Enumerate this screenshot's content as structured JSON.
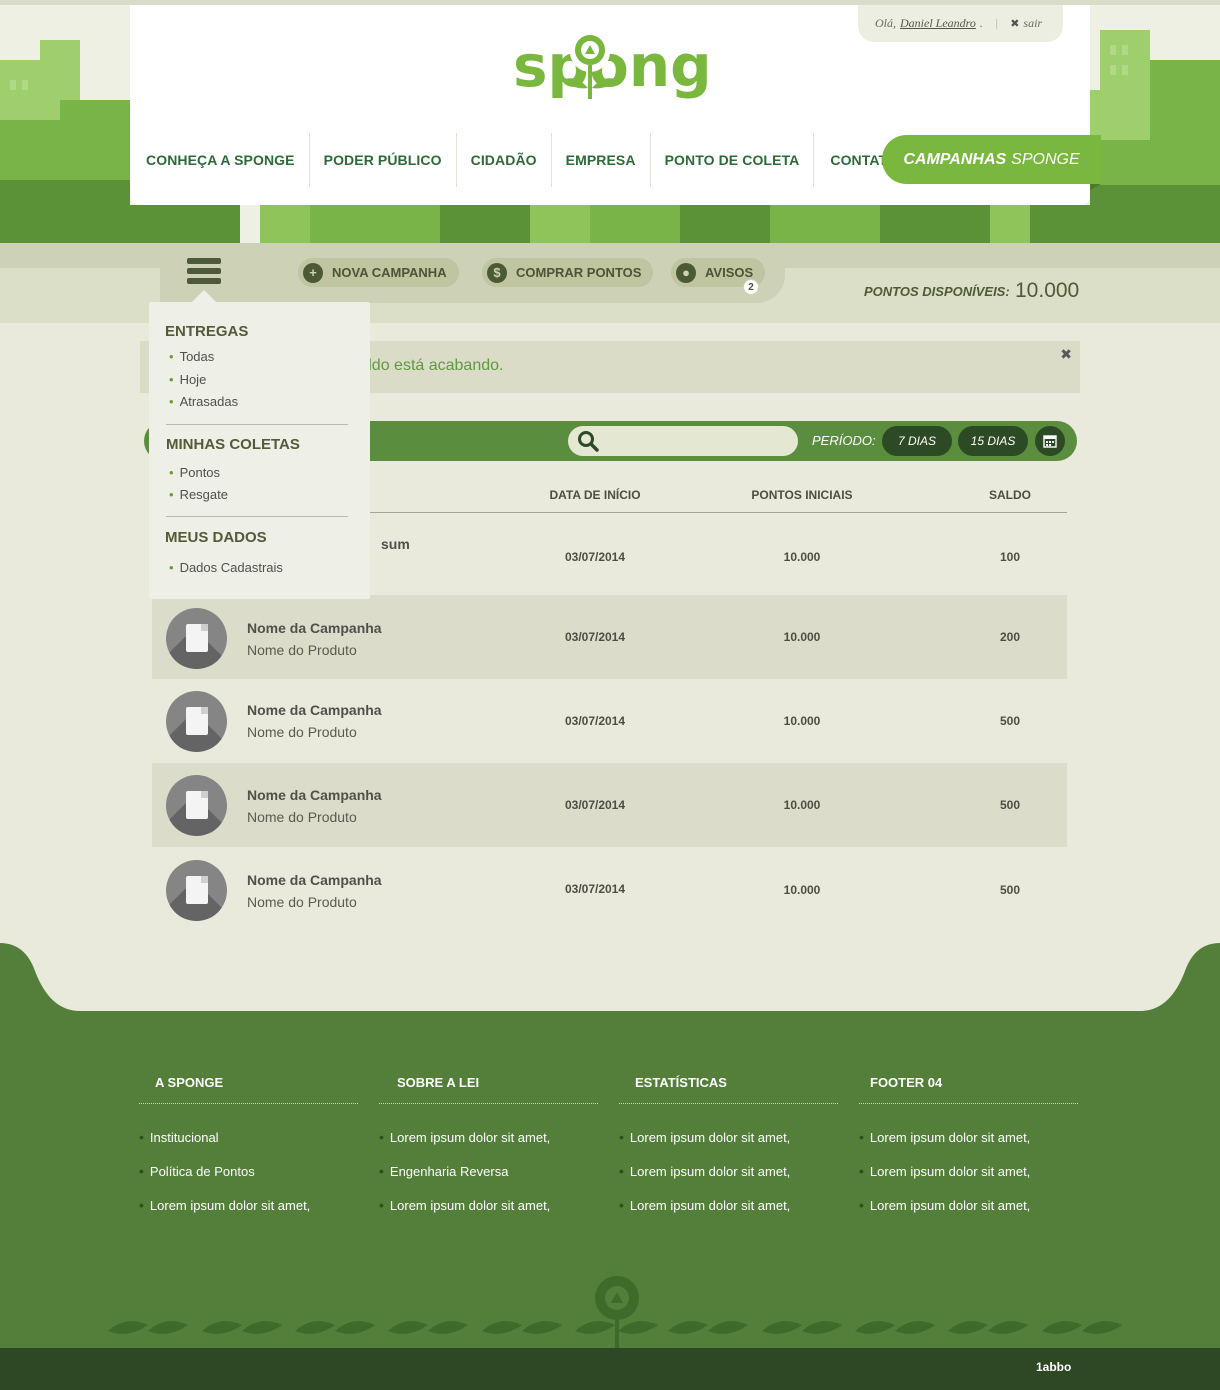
{
  "brand": {
    "logo_text": "sponge",
    "primary_green": "#79b73e",
    "dark_green": "#2d6a38",
    "footer_green": "#537f3a"
  },
  "user": {
    "greeting": "Olá,",
    "name": "Daniel Leandro",
    "punct": ".",
    "logout": "sair",
    "logout_icon": "close-icon"
  },
  "nav": {
    "items": [
      "CONHEÇA A SPONGE",
      "PODER PÚBLICO",
      "CIDADÃO",
      "EMPRESA",
      "PONTO DE COLETA",
      "CONTATO"
    ],
    "cta_bold": "CAMPANHAS",
    "cta_light": "SPONGE"
  },
  "toolbar": {
    "menu_icon": "hamburger-icon",
    "new_campaign": "NOVA CAMPANHA",
    "buy_points": "COMPRAR PONTOS",
    "notices": "AVISOS",
    "notices_count": "2",
    "points_label": "PONTOS DISPONÍVEIS:",
    "points_value": "10.000"
  },
  "alert": {
    "message": "u saldo está acabando.",
    "close": "✖"
  },
  "filter": {
    "search_placeholder": "",
    "period_label": "PERÍODO:",
    "btn_7": "7 DIAS",
    "btn_15": "15 DIAS",
    "calendar_icon": "calendar-icon"
  },
  "table": {
    "headers": [
      "DATA DE INÍCIO",
      "PONTOS INICIAIS",
      "SALDO"
    ],
    "first_row_fragment": "sum",
    "rows": [
      {
        "campaign": "",
        "product": "",
        "date": "03/07/2014",
        "initial": "10.000",
        "balance": "100"
      },
      {
        "campaign": "Nome da Campanha",
        "product": "Nome do Produto",
        "date": "03/07/2014",
        "initial": "10.000",
        "balance": "200"
      },
      {
        "campaign": "Nome da Campanha",
        "product": "Nome do Produto",
        "date": "03/07/2014",
        "initial": "10.000",
        "balance": "500"
      },
      {
        "campaign": "Nome da Campanha",
        "product": "Nome do Produto",
        "date": "03/07/2014",
        "initial": "10.000",
        "balance": "500"
      },
      {
        "campaign": "Nome da Campanha",
        "product": "Nome do Produto",
        "date": "03/07/2014",
        "initial": "10.000",
        "balance": "500"
      }
    ]
  },
  "dropdown": {
    "sections": [
      {
        "title": "ENTREGAS",
        "items": [
          "Todas",
          "Hoje",
          "Atrasadas"
        ]
      },
      {
        "title": "MINHAS COLETAS",
        "items": [
          "Pontos",
          "Resgate"
        ]
      },
      {
        "title": "MEUS DADOS",
        "items": [
          "Dados Cadastrais"
        ]
      }
    ]
  },
  "footer": {
    "columns": [
      {
        "title": "A SPONGE",
        "items": [
          "Institucional",
          "Política de Pontos",
          "Lorem ipsum dolor sit amet,"
        ]
      },
      {
        "title": "SOBRE A LEI",
        "items": [
          "Lorem ipsum dolor sit amet,",
          "Engenharia Reversa",
          "Lorem ipsum dolor sit amet,"
        ]
      },
      {
        "title": "ESTATÍSTICAS",
        "items": [
          "Lorem ipsum dolor sit amet,",
          "Lorem ipsum dolor sit amet,",
          "Lorem ipsum dolor sit amet,"
        ]
      },
      {
        "title": "FOOTER 04",
        "items": [
          "Lorem ipsum dolor sit amet,",
          "Lorem ipsum dolor sit amet,",
          "Lorem ipsum dolor sit amet,"
        ]
      }
    ],
    "credit": "1abbo"
  }
}
